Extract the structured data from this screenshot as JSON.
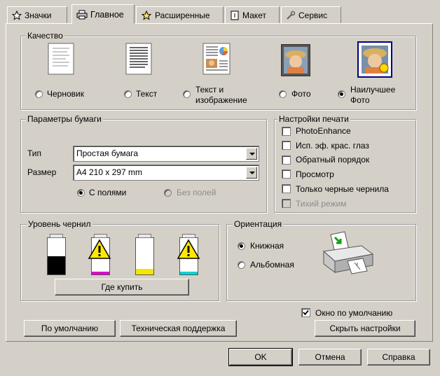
{
  "tabs": [
    {
      "label": "Значки",
      "icon": "star-icon"
    },
    {
      "label": "Главное",
      "icon": "printer-icon"
    },
    {
      "label": "Расширенные",
      "icon": "star-icon"
    },
    {
      "label": "Макет",
      "icon": "page-layout-icon"
    },
    {
      "label": "Сервис",
      "icon": "wrench-icon"
    }
  ],
  "active_tab": "Главное",
  "quality": {
    "title": "Качество",
    "options": [
      {
        "line1": "Черновик",
        "line2": "",
        "icon": "draft-document-icon",
        "selected": false
      },
      {
        "line1": "Текст",
        "line2": "",
        "icon": "text-document-icon",
        "selected": false
      },
      {
        "line1": "Текст и",
        "line2": "изображение",
        "icon": "text-image-document-icon",
        "selected": false
      },
      {
        "line1": "Фото",
        "line2": "",
        "icon": "photo-icon",
        "selected": false
      },
      {
        "line1": "Наилучшее",
        "line2": "Фото",
        "icon": "best-photo-icon",
        "selected": true
      }
    ]
  },
  "paper": {
    "title": "Параметры бумаги",
    "type_label": "Тип",
    "type_value": "Простая бумага",
    "size_label": "Размер",
    "size_value": "A4 210 x 297 mm",
    "margins": {
      "with": "С полями",
      "without": "Без полей",
      "selected": "with"
    }
  },
  "print_settings": {
    "title": "Настройки печати",
    "items": [
      {
        "label": "PhotoEnhance",
        "checked": false,
        "disabled": false
      },
      {
        "label": "Исп. эф. крас. глаз",
        "checked": false,
        "disabled": false
      },
      {
        "label": "Обратный порядок",
        "checked": false,
        "disabled": false
      },
      {
        "label": "Просмотр",
        "checked": false,
        "disabled": false
      },
      {
        "label": "Только черные чернила",
        "checked": false,
        "disabled": false
      },
      {
        "label": "Тихий режим",
        "checked": false,
        "disabled": true
      }
    ]
  },
  "ink": {
    "title": "Уровень чернил",
    "cartridges": [
      {
        "color": "#000000",
        "level": 0.5,
        "warning": false
      },
      {
        "color": "#e000c8",
        "level": 0.08,
        "warning": true
      },
      {
        "color": "#f5e600",
        "level": 0.15,
        "warning": false
      },
      {
        "color": "#00d4d4",
        "level": 0.08,
        "warning": true
      }
    ],
    "buy_label": "Где купить"
  },
  "orientation": {
    "title": "Ориентация",
    "portrait": "Книжная",
    "landscape": "Альбомная",
    "selected": "portrait",
    "icon": "printer-orientation-icon"
  },
  "default_window": {
    "label": "Окно по умолчанию",
    "checked": true
  },
  "buttons": {
    "defaults": "По умолчанию",
    "support": "Техническая поддержка",
    "hide": "Скрыть настройки",
    "ok": "OK",
    "cancel": "Отмена",
    "help": "Справка"
  },
  "colors": {
    "face": "#d4d0c8",
    "accent_border": "#000080"
  }
}
